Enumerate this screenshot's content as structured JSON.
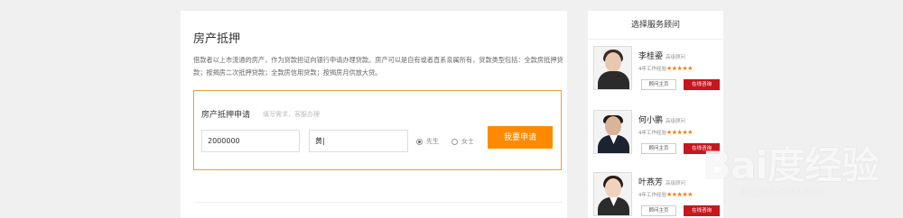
{
  "main": {
    "title": "房产抵押",
    "description": "借款者以上市流通的房产，作为贷款担证向银行申请办理贷款。房产可以是自有或者直系亲属所有，贷款类型包括：全款房抵押贷款；按揭房二次抵押贷款；全款房信用贷款；按揭房月供放大贷。",
    "form": {
      "title": "房产抵押申请",
      "hint": "填写需求，客服办理",
      "amount_value": "2000000",
      "name_value": "黄|",
      "gender_options": [
        "先生",
        "女士"
      ],
      "gender_selected": "先生",
      "submit_label": "我要申请"
    }
  },
  "sidebar": {
    "title": "选择服务顾问",
    "advisors": [
      {
        "name": "李桂鎏",
        "level": "高级顾问",
        "experience": "4年工作经验",
        "stars": "★★★★★",
        "profile_label": "顾问主页",
        "consult_label": "在线咨询"
      },
      {
        "name": "何小鹏",
        "level": "高级顾问",
        "experience": "4年工作经验",
        "stars": "★★★★★",
        "profile_label": "顾问主页",
        "consult_label": "在线咨询"
      },
      {
        "name": "叶燕芳",
        "level": "高级顾问",
        "experience": "4年工作经验",
        "stars": "★★★★★",
        "profile_label": "顾问主页",
        "consult_label": "在线咨询"
      }
    ]
  },
  "watermark": {
    "logo": "Bai度经验",
    "url": "jingyan.baidu.com"
  }
}
